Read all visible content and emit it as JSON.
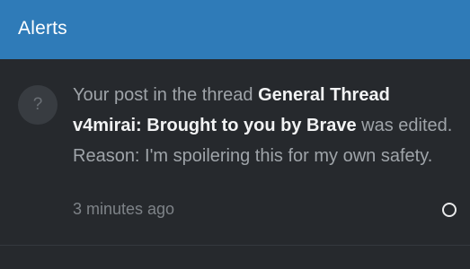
{
  "header": {
    "title": "Alerts"
  },
  "alerts": [
    {
      "avatar_placeholder": "?",
      "prefix": "Your post in the thread ",
      "thread_title": "General Thread v4mirai: Brought to you by Brave",
      "suffix": " was edited. Reason: I'm spoilering this for my own safety.",
      "time": "3 minutes ago",
      "read_toggle_icon": "circle-outline-icon"
    }
  ],
  "colors": {
    "header_bg": "#2f7bb8",
    "page_bg": "#26292d",
    "text_muted": "#9fa4a9",
    "text_strong": "#f2f3f4"
  }
}
